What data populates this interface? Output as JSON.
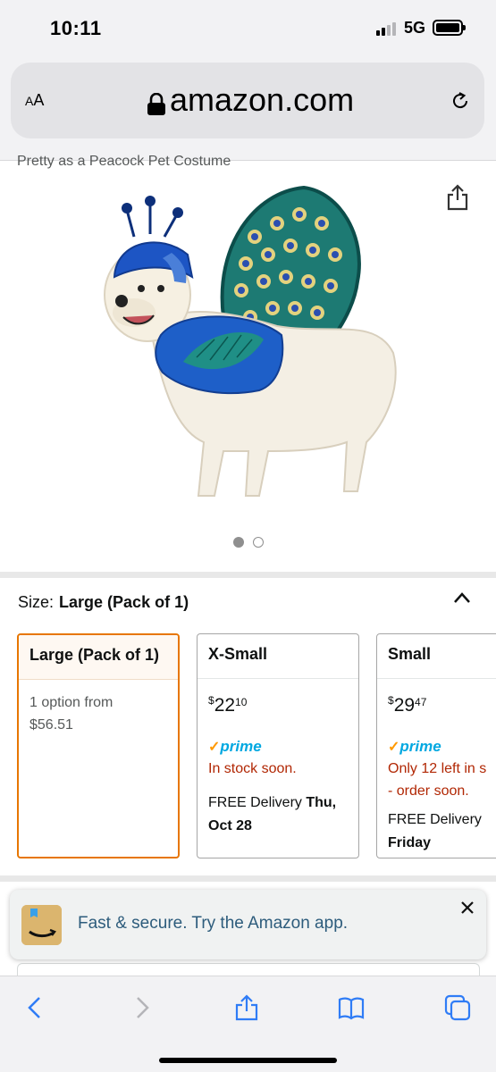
{
  "status": {
    "time": "10:11",
    "network": "5G"
  },
  "browser": {
    "text_size_label_small": "A",
    "text_size_label_large": "A",
    "url": "amazon.com"
  },
  "product": {
    "title_partial": "Pretty as a Peacock Pet Costume",
    "image_count": 2,
    "active_image_index": 0
  },
  "size_selector": {
    "label": "Size:",
    "selected_value": "Large (Pack of 1)",
    "options": [
      {
        "name": "Large (Pack of 1)",
        "line1": "1 option from",
        "line2": "$56.51"
      },
      {
        "name": "X-Small",
        "price_symbol": "$",
        "price_whole": "22",
        "price_fraction": "10",
        "prime_label": "prime",
        "stock": "In stock soon.",
        "delivery_prefix": "FREE Delivery",
        "delivery_date_1": "Thu,",
        "delivery_date_2": "Oct 28"
      },
      {
        "name": "Small",
        "price_symbol": "$",
        "price_whole": "29",
        "price_fraction": "47",
        "prime_label": "prime",
        "stock_1": "Only 12 left in s",
        "stock_2": "- order soon.",
        "delivery_prefix": "FREE Delivery",
        "delivery_date": "Friday"
      }
    ]
  },
  "app_banner": {
    "text": "Fast & secure. Try the Amazon app."
  },
  "colors": {
    "selected_border": "#e77600",
    "prime_blue": "#00a8e1",
    "stock_red": "#b12704",
    "ios_blue": "#2f7cf6"
  },
  "icons": [
    "lock-icon",
    "reload-icon",
    "share-icon",
    "chevron-up-icon",
    "close-icon",
    "back-icon",
    "forward-icon",
    "bookmarks-icon",
    "tabs-icon"
  ]
}
